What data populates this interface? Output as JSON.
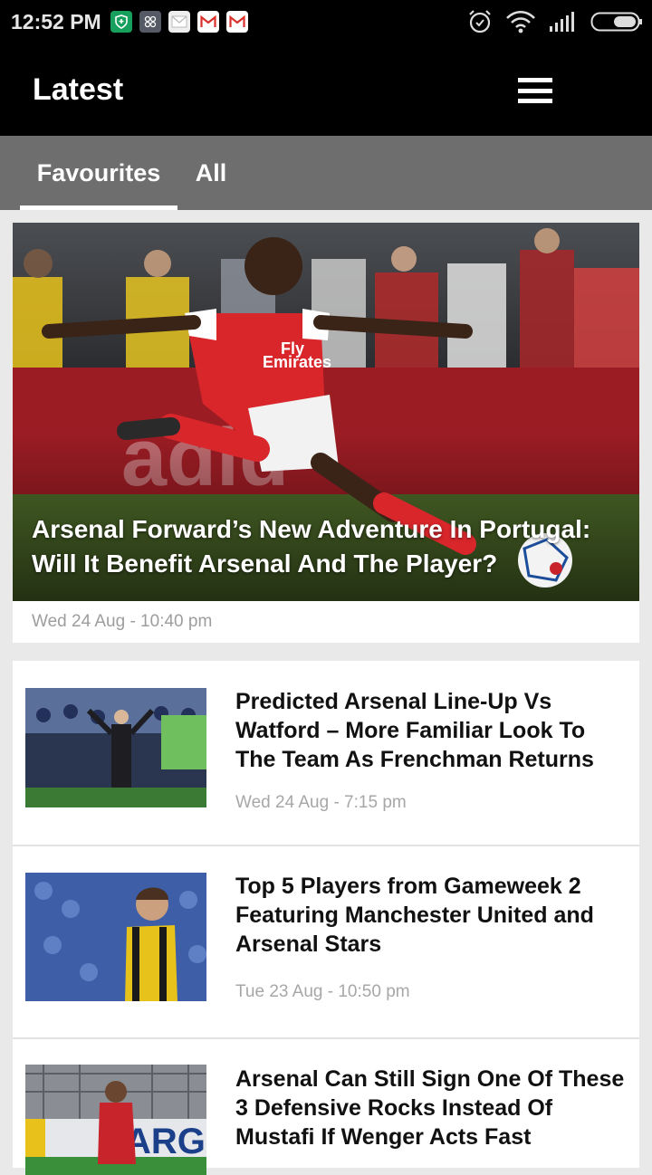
{
  "status_bar": {
    "time": "12:52 PM",
    "notification_icons": [
      "shield-icon",
      "app-icon",
      "mail-icon",
      "gmail-icon",
      "gmail-icon"
    ],
    "system_icons": [
      "alarm-icon",
      "wifi-icon",
      "signal-icon",
      "battery-icon"
    ]
  },
  "app_bar": {
    "title": "Latest",
    "menu_icon": "hamburger-menu-icon"
  },
  "tabs": [
    {
      "label": "Favourites",
      "selected": true
    },
    {
      "label": "All",
      "selected": false
    }
  ],
  "featured": {
    "title": "Arsenal Forward’s New Adventure In Portugal: Will It Benefit Arsenal And The Player?",
    "date": "Wed 24 Aug - 10:40 pm"
  },
  "articles": [
    {
      "title": "Predicted Arsenal Line-Up Vs Watford – More Familiar Look To The Team As Frenchman Returns",
      "date": "Wed 24 Aug - 7:15 pm"
    },
    {
      "title": "Top 5 Players from Gameweek 2 Featuring Manchester United and Arsenal Stars",
      "date": "Tue 23 Aug - 10:50 pm"
    },
    {
      "title": "Arsenal Can Still Sign One Of These 3 Defensive Rocks Instead Of Mustafi If Wenger Acts Fast",
      "date": ""
    }
  ],
  "colors": {
    "app_bar": "#000000",
    "tab_bar": "#6e6e6e",
    "background": "#e9e9e9",
    "date_text": "#a7a7a7"
  }
}
